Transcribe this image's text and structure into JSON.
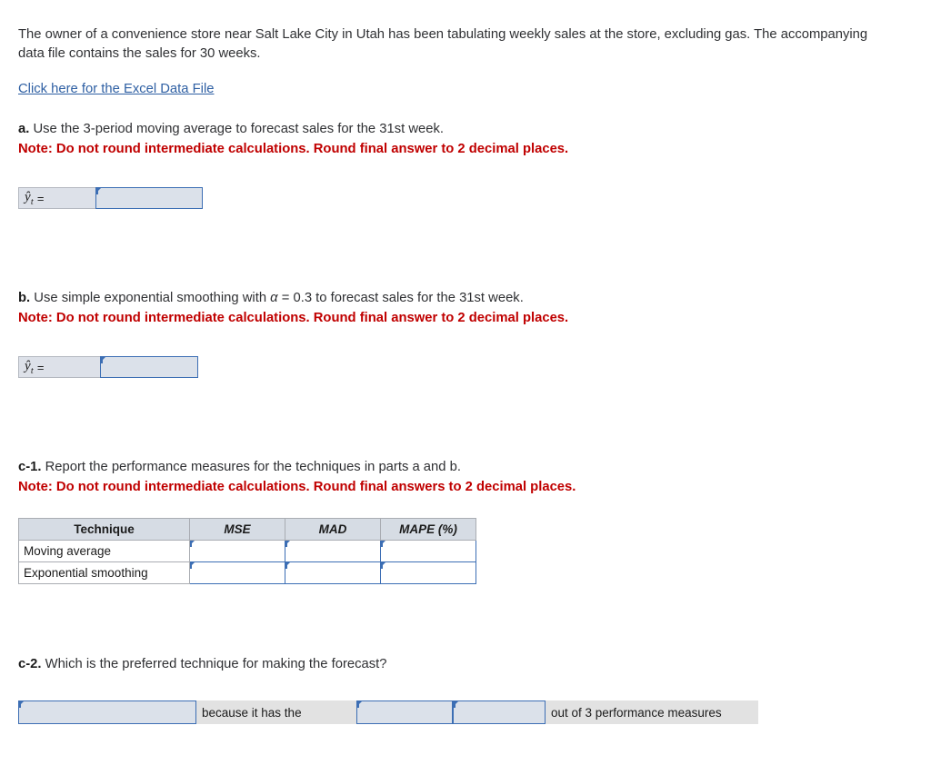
{
  "intro": {
    "paragraph": "The owner of a convenience store near Salt Lake City in Utah has been tabulating weekly sales at the store, excluding gas. The accompanying data file contains the sales for 30 weeks.",
    "excel_link_label": "Click here for the Excel Data File"
  },
  "part_a": {
    "marker": "a.",
    "prompt": " Use the 3-period moving average to forecast sales for the 31st week.",
    "note": "Note: Do not round intermediate calculations. Round final answer to 2 decimal places.",
    "answer_label_y": "ŷ",
    "answer_label_sub": "t",
    "answer_label_eq": "=",
    "answer_value": "",
    "answer_placeholder": ""
  },
  "part_b": {
    "marker": "b.",
    "prompt_before_alpha": " Use simple exponential smoothing with ",
    "alpha_symbol": "α",
    "prompt_after_alpha": " = 0.3 to forecast sales for the 31st week.",
    "note": "Note: Do not round intermediate calculations. Round final answer to 2 decimal places.",
    "answer_label_y": "ŷ",
    "answer_label_sub": "t",
    "answer_label_eq": "=",
    "answer_value": "",
    "answer_placeholder": ""
  },
  "part_c1": {
    "marker": "c-1.",
    "prompt": " Report the performance measures for the techniques in parts a and b.",
    "note": "Note: Do not round intermediate calculations. Round final answers to 2 decimal places.",
    "table": {
      "headers": [
        "Technique",
        "MSE",
        "MAD",
        "MAPE (%)"
      ],
      "rows": [
        {
          "label": "Moving average",
          "mse": "",
          "mad": "",
          "mape": ""
        },
        {
          "label": "Exponential smoothing",
          "mse": "",
          "mad": "",
          "mape": ""
        }
      ]
    }
  },
  "part_c2": {
    "marker": "c-2.",
    "prompt": " Which is the preferred technique for making the forecast?",
    "select_1_value": "",
    "text_1": "because it has the",
    "select_2_value": "",
    "select_3_value": "",
    "text_2": "out of 3 performance measures"
  },
  "colors": {
    "link": "#2e5fa3",
    "note_red": "#c00000",
    "input_border_blue": "#3c6eb4",
    "input_fill": "#dbe1ea",
    "header_fill": "#d6dce4",
    "strip_fill": "#e2e2e2"
  }
}
